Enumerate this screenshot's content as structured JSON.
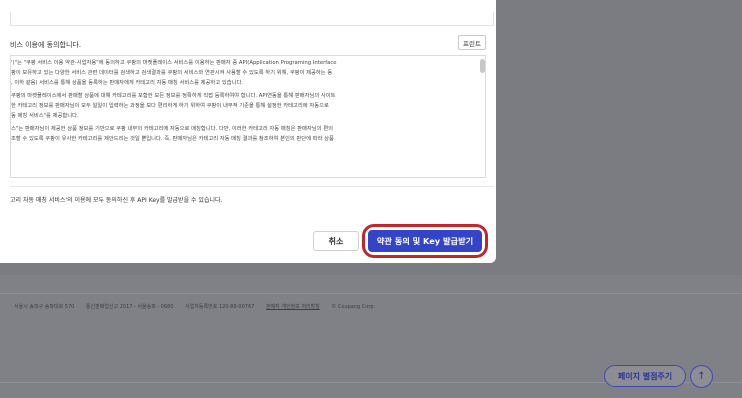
{
  "modal": {
    "agree_title": "비스 이용에 동의합니다.",
    "print_label": "프린트",
    "terms_lines": [
      "')\"는 \"쿠팡 서비스 이용 약관-사업자용\"에 동의하고 쿠팡의 마켓플레이스 서비스를 이용하는 판매자 중 API(Application Programing Interface",
      "팡이 보유하고 있는 다양한 서비스 관련 데이터를 검색하고 검색결과를 쿠팡의 서비스와 연관시켜 사용할 수 있도록 하기 위해, 쿠팡이 제공하는 동",
      ", 이하 같음) 서비스를 통해 상품을 등록하는 판매자에게 카테고리 자동 매칭 서비스를 제공하고 있습니다.",
      "쿠팡의 마켓플레이스에서 판매할 상품에 대해 카테고리를 포함한 모든 정보를 정확하게 직접 등록하여야 합니다. API연동을 통해 판매자님의 사이트",
      "한 카테고리 정보를 판매자님이 모두 일일이 입력하는 과정을 보다 편리하게 하기 위하여 쿠팡이 내부적 기준을 통해 설정한 카테고리에 자동으로",
      "동 매칭 서비스\"를 제공합니다.",
      "스\"는 판매자님이 제공한 상품 정보를 기반으로 쿠팡 내부의 카테고리에 자동으로 매칭합니다. 다만, 이러한 카테고리 자동 매칭은 판매자님의 편의",
      "조할 수 있도록 쿠팡이 유사한 카테고리를 제안드리는 것일 뿐입니다. 즉, 판매자님은 카테고리 자동 매칭 결과를 참조하여 본인의 판단에 따라 상품"
    ],
    "notice": "고리 자동 매칭 서비스'의 이용에 모두 동의하신 후 API Key를 발급받을 수 있습니다.",
    "cancel_label": "취소",
    "primary_label": "약관 동의 및 Key 발급받기"
  },
  "footer": {
    "address": "서울시 송파구 송파대로 570",
    "telecom": "통신판매업신고 2017 - 서울송파 - 0680",
    "business": "사업자등록번호 120-88-00767",
    "privacy": "판매자 개인정보 처리방침",
    "copyright": "© Coupang Corp."
  },
  "page_button_label": "페이지 별점주기",
  "top_button_glyph": "↑",
  "colors": {
    "primary": "#3344c8",
    "highlight_ring": "#c0272d",
    "overlay": "#7a7c81"
  }
}
